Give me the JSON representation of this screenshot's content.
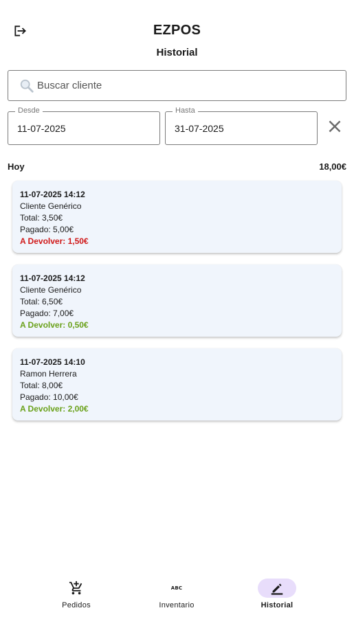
{
  "header": {
    "app_title": "EZPOS",
    "page_title": "Historial",
    "logout_icon": "logout-icon"
  },
  "search": {
    "placeholder": "Buscar cliente",
    "value": ""
  },
  "filters": {
    "desde_label": "Desde",
    "desde_value": "11-07-2025",
    "hasta_label": "Hasta",
    "hasta_value": "31-07-2025"
  },
  "group": {
    "label": "Hoy",
    "total": "18,00€"
  },
  "orders": [
    {
      "datetime": "11-07-2025 14:12",
      "customer": "Cliente Genérico",
      "total": "Total: 3,50€",
      "paid": "Pagado: 5,00€",
      "change": "A Devolver: 1,50€",
      "change_color": "#d01919"
    },
    {
      "datetime": "11-07-2025 14:12",
      "customer": "Cliente Genérico",
      "total": "Total: 6,50€",
      "paid": "Pagado: 7,00€",
      "change": "A Devolver: 0,50€",
      "change_color": "#6aa11a"
    },
    {
      "datetime": "11-07-2025 14:10",
      "customer": "Ramon Herrera",
      "total": "Total: 8,00€",
      "paid": "Pagado: 10,00€",
      "change": "A Devolver: 2,00€",
      "change_color": "#6aa11a"
    }
  ],
  "nav": {
    "items": [
      {
        "label": "Pedidos",
        "icon": "add-cart-icon",
        "active": false
      },
      {
        "label": "Inventario",
        "icon": "abc-icon",
        "icon_text": "ABC",
        "active": false
      },
      {
        "label": "Historial",
        "icon": "edit-icon",
        "active": true
      }
    ],
    "active_color": "#e8ddfb"
  }
}
